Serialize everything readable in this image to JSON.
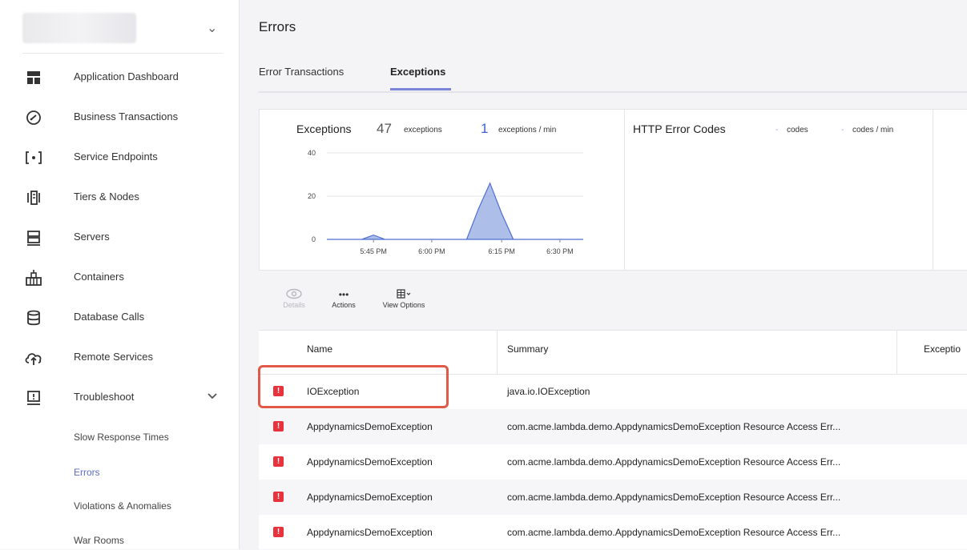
{
  "sidebar": {
    "app_selector_chevron": "⌄",
    "items": [
      {
        "label": "Application Dashboard",
        "icon": "dashboard-icon"
      },
      {
        "label": "Business Transactions",
        "icon": "gauge-icon"
      },
      {
        "label": "Service Endpoints",
        "icon": "endpoint-icon"
      },
      {
        "label": "Tiers & Nodes",
        "icon": "tiers-icon"
      },
      {
        "label": "Servers",
        "icon": "server-icon"
      },
      {
        "label": "Containers",
        "icon": "container-icon"
      },
      {
        "label": "Database Calls",
        "icon": "database-icon"
      },
      {
        "label": "Remote Services",
        "icon": "cloud-upload-icon"
      },
      {
        "label": "Troubleshoot",
        "icon": "troubleshoot-icon",
        "expanded": true
      }
    ],
    "sub_items": [
      {
        "label": "Slow Response Times",
        "active": false
      },
      {
        "label": "Errors",
        "active": true
      },
      {
        "label": "Violations & Anomalies",
        "active": false
      },
      {
        "label": "War Rooms",
        "active": false
      }
    ]
  },
  "main": {
    "title": "Errors",
    "tabs": [
      {
        "label": "Error Transactions",
        "active": false
      },
      {
        "label": "Exceptions",
        "active": true
      }
    ],
    "exceptions_widget": {
      "title": "Exceptions",
      "count": "47",
      "count_unit": "exceptions",
      "rate": "1",
      "rate_unit": "exceptions / min"
    },
    "http_widget": {
      "title": "HTTP Error Codes",
      "codes_value": "-",
      "codes_unit": "codes",
      "rate_value": "-",
      "rate_unit": "codes / min"
    },
    "toolbar": {
      "details_label": "Details",
      "actions_label": "Actions",
      "view_options_label": "View Options"
    },
    "table": {
      "columns": [
        "Name",
        "Summary",
        "Exceptio"
      ],
      "rows": [
        {
          "name": "IOException",
          "summary": "java.io.IOException"
        },
        {
          "name": "AppdynamicsDemoException",
          "summary": "com.acme.lambda.demo.AppdynamicsDemoException Resource Access Err..."
        },
        {
          "name": "AppdynamicsDemoException",
          "summary": "com.acme.lambda.demo.AppdynamicsDemoException Resource Access Err..."
        },
        {
          "name": "AppdynamicsDemoException",
          "summary": "com.acme.lambda.demo.AppdynamicsDemoException Resource Access Err..."
        },
        {
          "name": "AppdynamicsDemoException",
          "summary": "com.acme.lambda.demo.AppdynamicsDemoException Resource Access Err..."
        }
      ],
      "error_badge": "!"
    }
  },
  "chart_data": {
    "type": "area",
    "title": "",
    "x_tick_labels": [
      "5:45 PM",
      "6:00 PM",
      "6:15 PM",
      "6:30 PM"
    ],
    "y_tick_labels": [
      "40",
      "20",
      "0"
    ],
    "ylim": [
      0,
      40
    ],
    "series": [
      {
        "x": [
          "5:35 PM",
          "5:38 PM",
          "5:41 PM",
          "5:44 PM",
          "5:47 PM",
          "5:50 PM",
          "5:53 PM",
          "5:56 PM",
          "5:59 PM",
          "6:02 PM",
          "6:05 PM",
          "6:08 PM",
          "6:11 PM",
          "6:13 PM",
          "6:14 PM",
          "6:15 PM",
          "6:17 PM",
          "6:20 PM",
          "6:23 PM",
          "6:26 PM",
          "6:29 PM",
          "6:32 PM",
          "6:35 PM"
        ],
        "values": [
          0,
          0,
          0,
          0,
          2,
          0,
          0,
          0,
          0,
          0,
          0,
          0,
          0,
          14,
          26,
          12,
          0,
          0,
          0,
          0,
          0,
          0,
          0
        ]
      }
    ],
    "color": "#8aa3e0",
    "grid": true
  }
}
